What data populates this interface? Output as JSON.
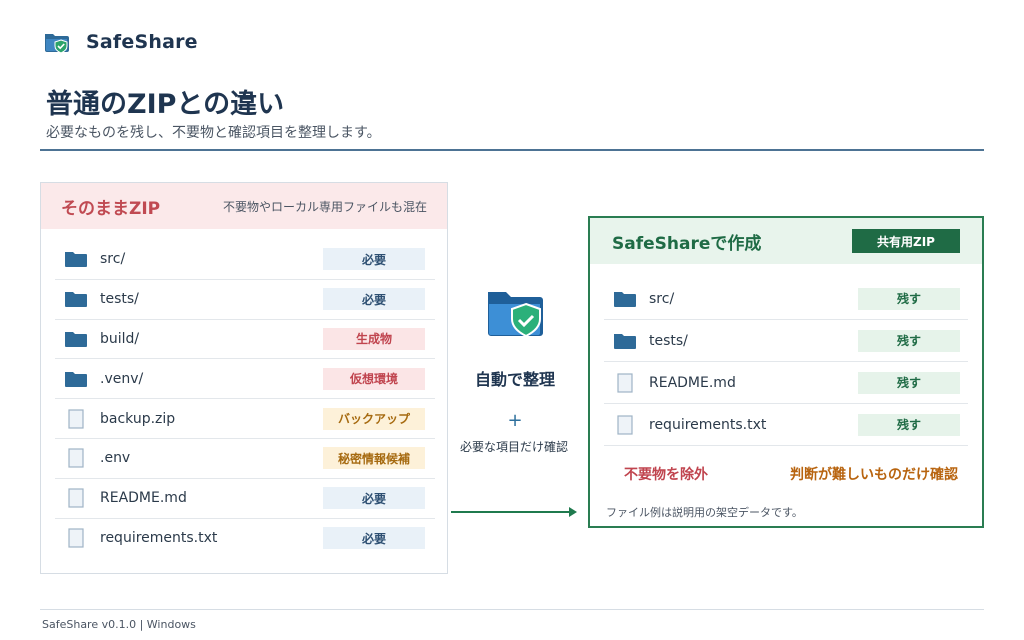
{
  "app": {
    "title": "SafeShare",
    "logo_icon": "shield-folder-icon"
  },
  "page": {
    "title": "普通のZIPとの違い",
    "subtitle": "必要なものを残し、不要物と確認項目を整理します。"
  },
  "left_panel": {
    "title": "そのままZIP",
    "note": "不要物やローカル専用ファイルも混在",
    "files": [
      {
        "name": "src/",
        "icon": "folder-icon",
        "tag": "必要",
        "tag_type": "need"
      },
      {
        "name": "tests/",
        "icon": "folder-icon",
        "tag": "必要",
        "tag_type": "need"
      },
      {
        "name": "build/",
        "icon": "folder-icon",
        "tag": "生成物",
        "tag_type": "gen"
      },
      {
        "name": ".venv/",
        "icon": "folder-icon",
        "tag": "仮想環境",
        "tag_type": "venv"
      },
      {
        "name": "backup.zip",
        "icon": "file-icon",
        "tag": "バックアップ",
        "tag_type": "backup"
      },
      {
        "name": ".env",
        "icon": "file-icon",
        "tag": "秘密情報候補",
        "tag_type": "secret"
      },
      {
        "name": "README.md",
        "icon": "file-icon",
        "tag": "必要",
        "tag_type": "need"
      },
      {
        "name": "requirements.txt",
        "icon": "file-icon",
        "tag": "必要",
        "tag_type": "need"
      }
    ]
  },
  "middle": {
    "icon": "shield-folder-icon",
    "main_label": "自動で整理",
    "plus": "+",
    "sub_label": "必要な項目だけ確認"
  },
  "right_panel": {
    "title": "SafeShareで作成",
    "badge": "共有用ZIP",
    "files": [
      {
        "name": "src/",
        "icon": "folder-icon",
        "tag": "残す"
      },
      {
        "name": "tests/",
        "icon": "folder-icon",
        "tag": "残す"
      },
      {
        "name": "README.md",
        "icon": "file-icon",
        "tag": "残す"
      },
      {
        "name": "requirements.txt",
        "icon": "file-icon",
        "tag": "残す"
      }
    ],
    "exclude_label": "不要物を除外",
    "confirm_label": "判断が難しいものだけ確認",
    "footnote": "ファイル例は説明用の架空データです。"
  },
  "footer": {
    "text": "SafeShare v0.1.0 | Windows"
  },
  "colors": {
    "primary": "#1f3550",
    "rule": "#4d7394",
    "danger": "#c0444e",
    "warn": "#b8640f",
    "success": "#1f6b45",
    "folder": "#2e6a98"
  }
}
